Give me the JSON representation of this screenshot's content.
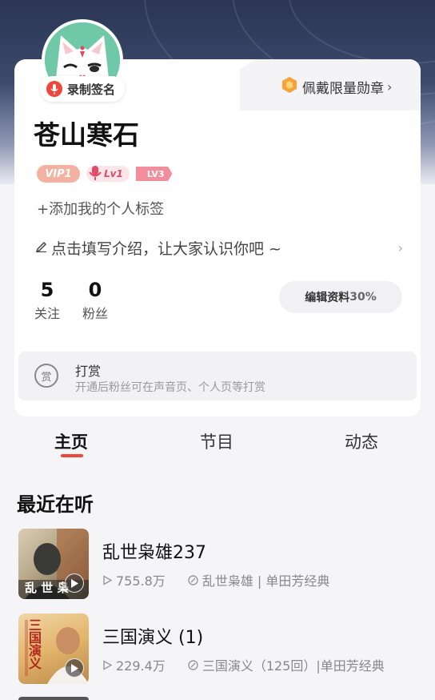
{
  "profile": {
    "record_label": "录制签名",
    "medal_label": "佩戴限量勋章",
    "nickname": "苍山寒石",
    "badges": {
      "vip": "VIP1",
      "level": "Lv1",
      "level3": "LV3"
    },
    "add_tag": "+添加我的个人标签",
    "intro": "点击填写介绍，让大家认识你吧 ~",
    "stats": [
      {
        "value": "5",
        "label": "关注"
      },
      {
        "value": "0",
        "label": "粉丝"
      }
    ],
    "edit_label": "编辑资料",
    "edit_progress": "30%"
  },
  "reward": {
    "icon_text": "赏",
    "title": "打赏",
    "description": "开通后粉丝可在声音页、个人页等打赏"
  },
  "tabs": [
    {
      "label": "主页",
      "active": true
    },
    {
      "label": "节目",
      "active": false
    },
    {
      "label": "动态",
      "active": false
    }
  ],
  "recent": {
    "title": "最近在听",
    "items": [
      {
        "title": "乱世枭雄237",
        "plays": "755.8万",
        "album": "乱世枭雄 | 单田芳经典",
        "cover_text": "乱 世 枭"
      },
      {
        "title": "三国演义 (1)",
        "plays": "229.4万",
        "album": "三国演义（125回）|单田芳经典",
        "cover_text": "三国演义"
      }
    ]
  },
  "colors": {
    "accent": "#f0473d",
    "vip": "#f3b2a1",
    "level": "#e24b66"
  }
}
